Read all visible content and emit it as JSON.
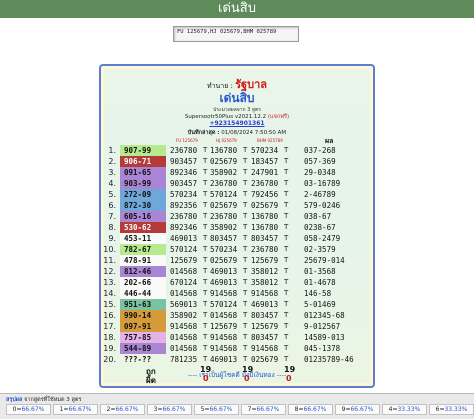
{
  "header": {
    "title": "เด่นสิบ"
  },
  "input": {
    "value": "FU 125679,HJ 025679,BHM 025789"
  },
  "panel": {
    "prefix": "ทำนาย : ",
    "name": "รัฐบาล",
    "subtitle": "เด่นสิบ",
    "calc_line": "ประมวลผลจาก 3 สูตร",
    "version": "Supersootr50Plus v2021.12.2",
    "version_free": "(แจกฟรี)",
    "phone": "+923154901361",
    "record_label": "บันทึกล่าสุด :",
    "record_value": "01/08/2024 7:50:50 AM",
    "col_fu": "FU 125679",
    "col_hj": "HJ 025679",
    "col_bhm": "BHM 025789",
    "col_main": "ผล",
    "rows": [
      {
        "n": "1.",
        "pair": "907-99",
        "color": "lime",
        "c1": "236780",
        "c2": "136780",
        "c3": "570234",
        "r": "037-268"
      },
      {
        "n": "2.",
        "pair": "906-71",
        "color": "red",
        "c1": "903457",
        "c2": "025679",
        "c3": "183457",
        "r": "057-369"
      },
      {
        "n": "3.",
        "pair": "091-65",
        "color": "purple",
        "c1": "892346",
        "c2": "358902",
        "c3": "247901",
        "r": "29-0348"
      },
      {
        "n": "4.",
        "pair": "903-99",
        "color": "purple",
        "c1": "903457",
        "c2": "236780",
        "c3": "236780",
        "r": "03-16789"
      },
      {
        "n": "5.",
        "pair": "272-09",
        "color": "blue",
        "c1": "570234",
        "c2": "570124",
        "c3": "792456",
        "r": "2-46789"
      },
      {
        "n": "6.",
        "pair": "872-30",
        "color": "blue",
        "c1": "892356",
        "c2": "025679",
        "c3": "025679",
        "r": "579-0246"
      },
      {
        "n": "7.",
        "pair": "605-16",
        "color": "purple",
        "c1": "236780",
        "c2": "236780",
        "c3": "136780",
        "r": "038-67"
      },
      {
        "n": "8.",
        "pair": "530-62",
        "color": "red",
        "c1": "892346",
        "c2": "358902",
        "c3": "136780",
        "r": "0238-67"
      },
      {
        "n": "9.",
        "pair": "453-11",
        "color": "white",
        "c1": "469013",
        "c2": "803457",
        "c3": "803457",
        "r": "058-2479"
      },
      {
        "n": "10.",
        "pair": "782-67",
        "color": "lime",
        "c1": "570124",
        "c2": "570234",
        "c3": "236780",
        "r": "02-3579"
      },
      {
        "n": "11.",
        "pair": "478-91",
        "color": "white",
        "c1": "125679",
        "c2": "025679",
        "c3": "125679",
        "r": "25679-014"
      },
      {
        "n": "12.",
        "pair": "812-46",
        "color": "purple",
        "c1": "014568",
        "c2": "469013",
        "c3": "358012",
        "r": "01-3568"
      },
      {
        "n": "13.",
        "pair": "202-66",
        "color": "white",
        "c1": "670124",
        "c2": "469013",
        "c3": "358012",
        "r": "01-4678"
      },
      {
        "n": "14.",
        "pair": "446-44",
        "color": "white",
        "c1": "014568",
        "c2": "914568",
        "c3": "914568",
        "r": "146-58"
      },
      {
        "n": "15.",
        "pair": "951-63",
        "color": "green",
        "c1": "569013",
        "c2": "570124",
        "c3": "469013",
        "r": "5-01469"
      },
      {
        "n": "16.",
        "pair": "990-14",
        "color": "orange",
        "c1": "358902",
        "c2": "014568",
        "c3": "803457",
        "r": "012345-68"
      },
      {
        "n": "17.",
        "pair": "097-91",
        "color": "orange",
        "c1": "914568",
        "c2": "125679",
        "c3": "125679",
        "r": "9-012567"
      },
      {
        "n": "18.",
        "pair": "757-85",
        "color": "pink",
        "c1": "014568",
        "c2": "914568",
        "c3": "803457",
        "r": "14589-013"
      },
      {
        "n": "19.",
        "pair": "544-89",
        "color": "purple",
        "c1": "014568",
        "c2": "914568",
        "c3": "914568",
        "r": "045-1378"
      },
      {
        "n": "20.",
        "pair": "???-??",
        "color": "none",
        "c1": "781235",
        "c2": "469013",
        "c3": "025679",
        "r": "01235789-46"
      }
    ],
    "correct_label": "ถูก",
    "wrong_label": "ผิด",
    "correct": [
      "19",
      "19",
      "19"
    ],
    "wrong": [
      "0",
      "0",
      "0"
    ],
    "slogan": "---- เราเป็นผู้โชคดี มั่งมีเงินทอง ----"
  },
  "bottom": {
    "title": "สรุปผล",
    "title_rest": "จากสูตรที่ใช้หมด 3 สูตร",
    "items": [
      {
        "label": "0=",
        "pct": "66.67%"
      },
      {
        "label": "1=",
        "pct": "66.67%"
      },
      {
        "label": "2=",
        "pct": "66.67%"
      },
      {
        "label": "3=",
        "pct": "66.67%"
      },
      {
        "label": "5=",
        "pct": "66.67%"
      },
      {
        "label": "7=",
        "pct": "66.67%"
      },
      {
        "label": "8=",
        "pct": "66.67%"
      },
      {
        "label": "9=",
        "pct": "66.67%"
      },
      {
        "label": "4=",
        "pct": "33.33%"
      },
      {
        "label": "6=",
        "pct": "33.33%"
      }
    ]
  }
}
